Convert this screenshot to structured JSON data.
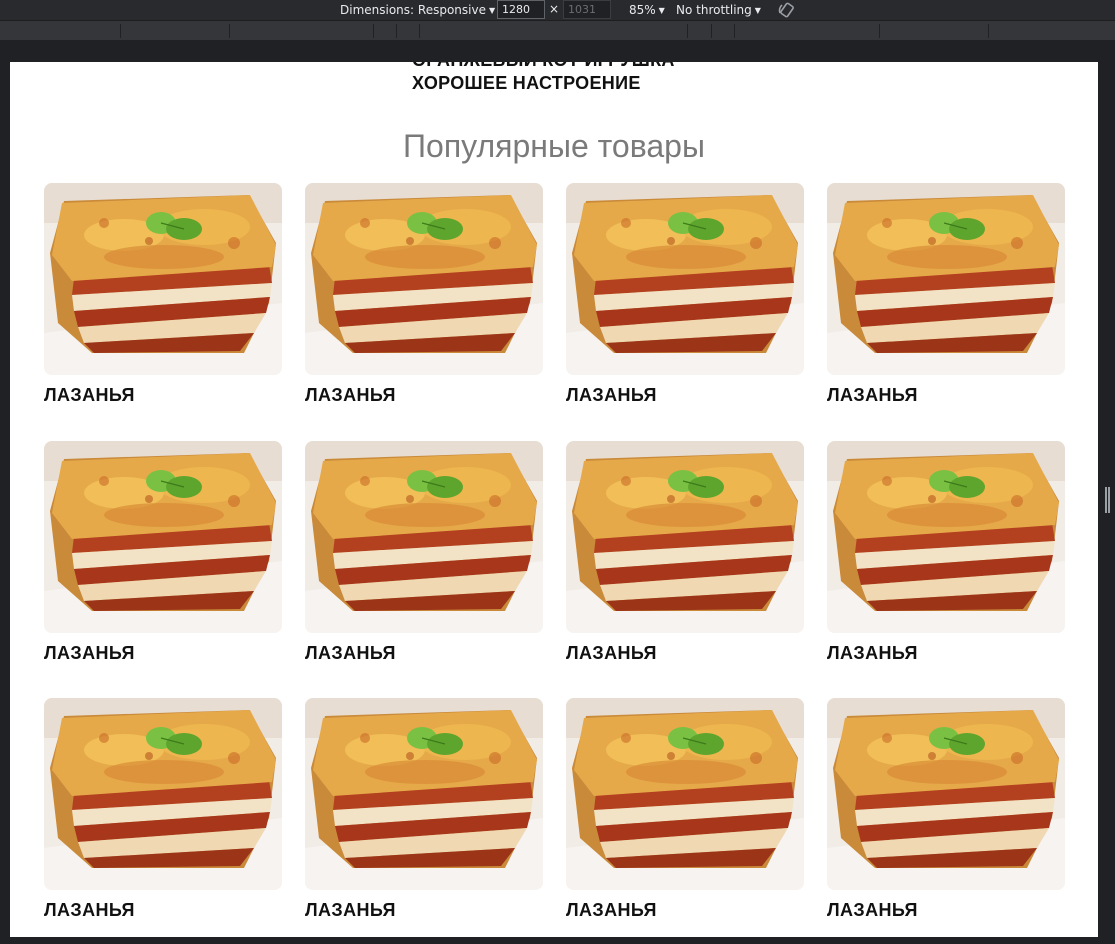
{
  "devtools": {
    "dimensions_label": "Dimensions: Responsive",
    "width_value": "1280",
    "height_value": "1031",
    "separator": "×",
    "zoom": "85%",
    "throttling": "No throttling",
    "icons": [
      "caret-down-icon",
      "rotate-icon",
      "resize-handle-icon"
    ]
  },
  "page": {
    "hero_line_1": "ОРАНЖЕВЫЙ КОТ ИГРУШКА",
    "hero_line_2": "ХОРОШЕЕ НАСТРОЕНИЕ",
    "section_title": "Популярные товары",
    "products": [
      {
        "name": "ЛАЗАНЬЯ"
      },
      {
        "name": "ЛАЗАНЬЯ"
      },
      {
        "name": "ЛАЗАНЬЯ"
      },
      {
        "name": "ЛАЗАНЬЯ"
      },
      {
        "name": "ЛАЗАНЬЯ"
      },
      {
        "name": "ЛАЗАНЬЯ"
      },
      {
        "name": "ЛАЗАНЬЯ"
      },
      {
        "name": "ЛАЗАНЬЯ"
      },
      {
        "name": "ЛАЗАНЬЯ"
      },
      {
        "name": "ЛАЗАНЬЯ"
      },
      {
        "name": "ЛАЗАНЬЯ"
      },
      {
        "name": "ЛАЗАНЬЯ"
      }
    ]
  },
  "colors": {
    "devtools_bg": "#292a2d",
    "page_bg": "#ffffff",
    "title_gray": "#7a7a7a",
    "text_dark": "#111111"
  }
}
